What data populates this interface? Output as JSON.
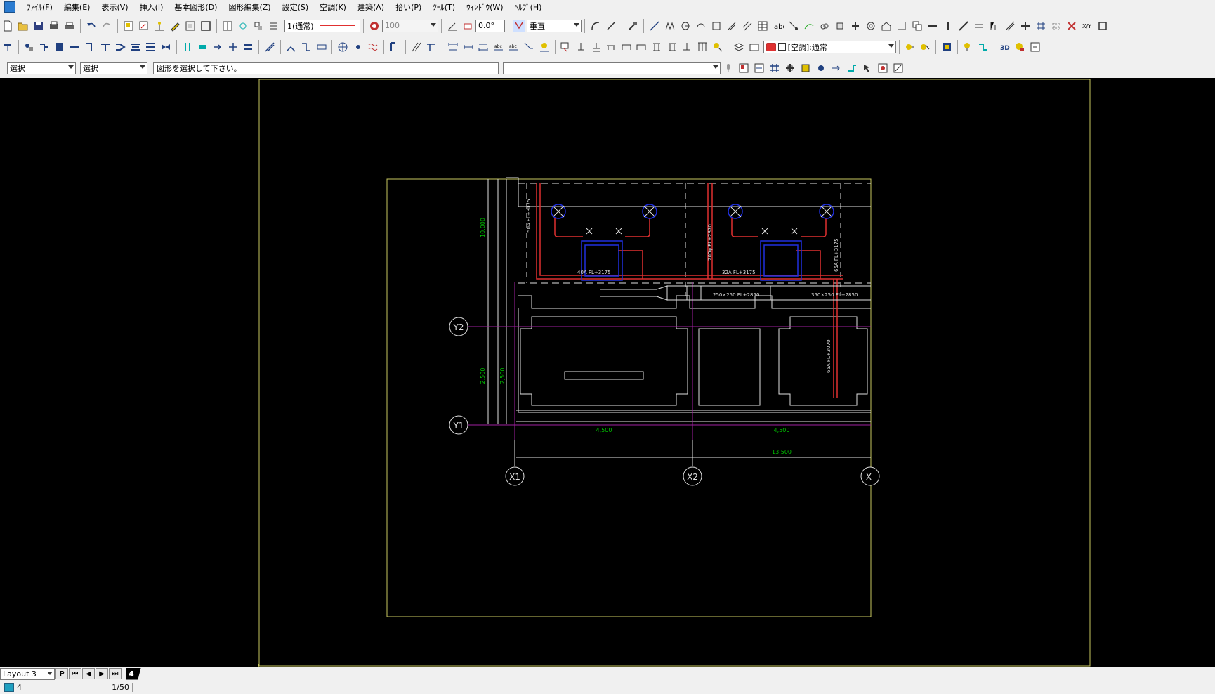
{
  "menu": [
    "ﾌｧｲﾙ(F)",
    "編集(E)",
    "表示(V)",
    "挿入(I)",
    "基本図形(D)",
    "図形編集(Z)",
    "設定(S)",
    "空調(K)",
    "建築(A)",
    "拾い(P)",
    "ﾂｰﾙ(T)",
    "ｳｨﾝﾄﾞｳ(W)",
    "ﾍﾙﾌﾟ(H)"
  ],
  "toolbar1": {
    "linetype": "1(通常)",
    "scale": "100",
    "angle": "0.0°",
    "orientation": "垂直"
  },
  "toolbar2": {
    "layer_combo": "[空調]:通常"
  },
  "toolbar3": {
    "mode1": "選択",
    "mode2": "選択",
    "prompt": "図形を選択して下さい。",
    "command": ""
  },
  "drawing": {
    "grid_y": [
      "Y2",
      "Y1"
    ],
    "grid_x": [
      "X1",
      "X2",
      "X"
    ],
    "dims": {
      "h1": "4,500",
      "h2": "4,500",
      "total": "13,500",
      "v1": "10,000",
      "v2": "2,500",
      "v3": "2,500"
    },
    "labels": {
      "pipe1": "40A FL+3175",
      "pipe2": "32A FL+3175",
      "pipe_v1": "50A FL+3075",
      "pipe_v2": "200φ FL+2870",
      "pipe_v3": "65A FL+3175",
      "pipe_v4": "65A FL+3070",
      "duct1": "250×250 FL+2850",
      "duct2": "350×250 FL+2850"
    }
  },
  "tabs": {
    "layout_name": "Layout 3",
    "p_label": "P",
    "page_num": "4"
  },
  "status": {
    "layer_num": "4",
    "scale": "1/50"
  },
  "colors": {
    "sheet_border": "#c8c860",
    "grid_line": "#a020a0",
    "dim_text": "#00c000",
    "pipe_red": "#e03030",
    "equip_blue": "#2030e0"
  }
}
